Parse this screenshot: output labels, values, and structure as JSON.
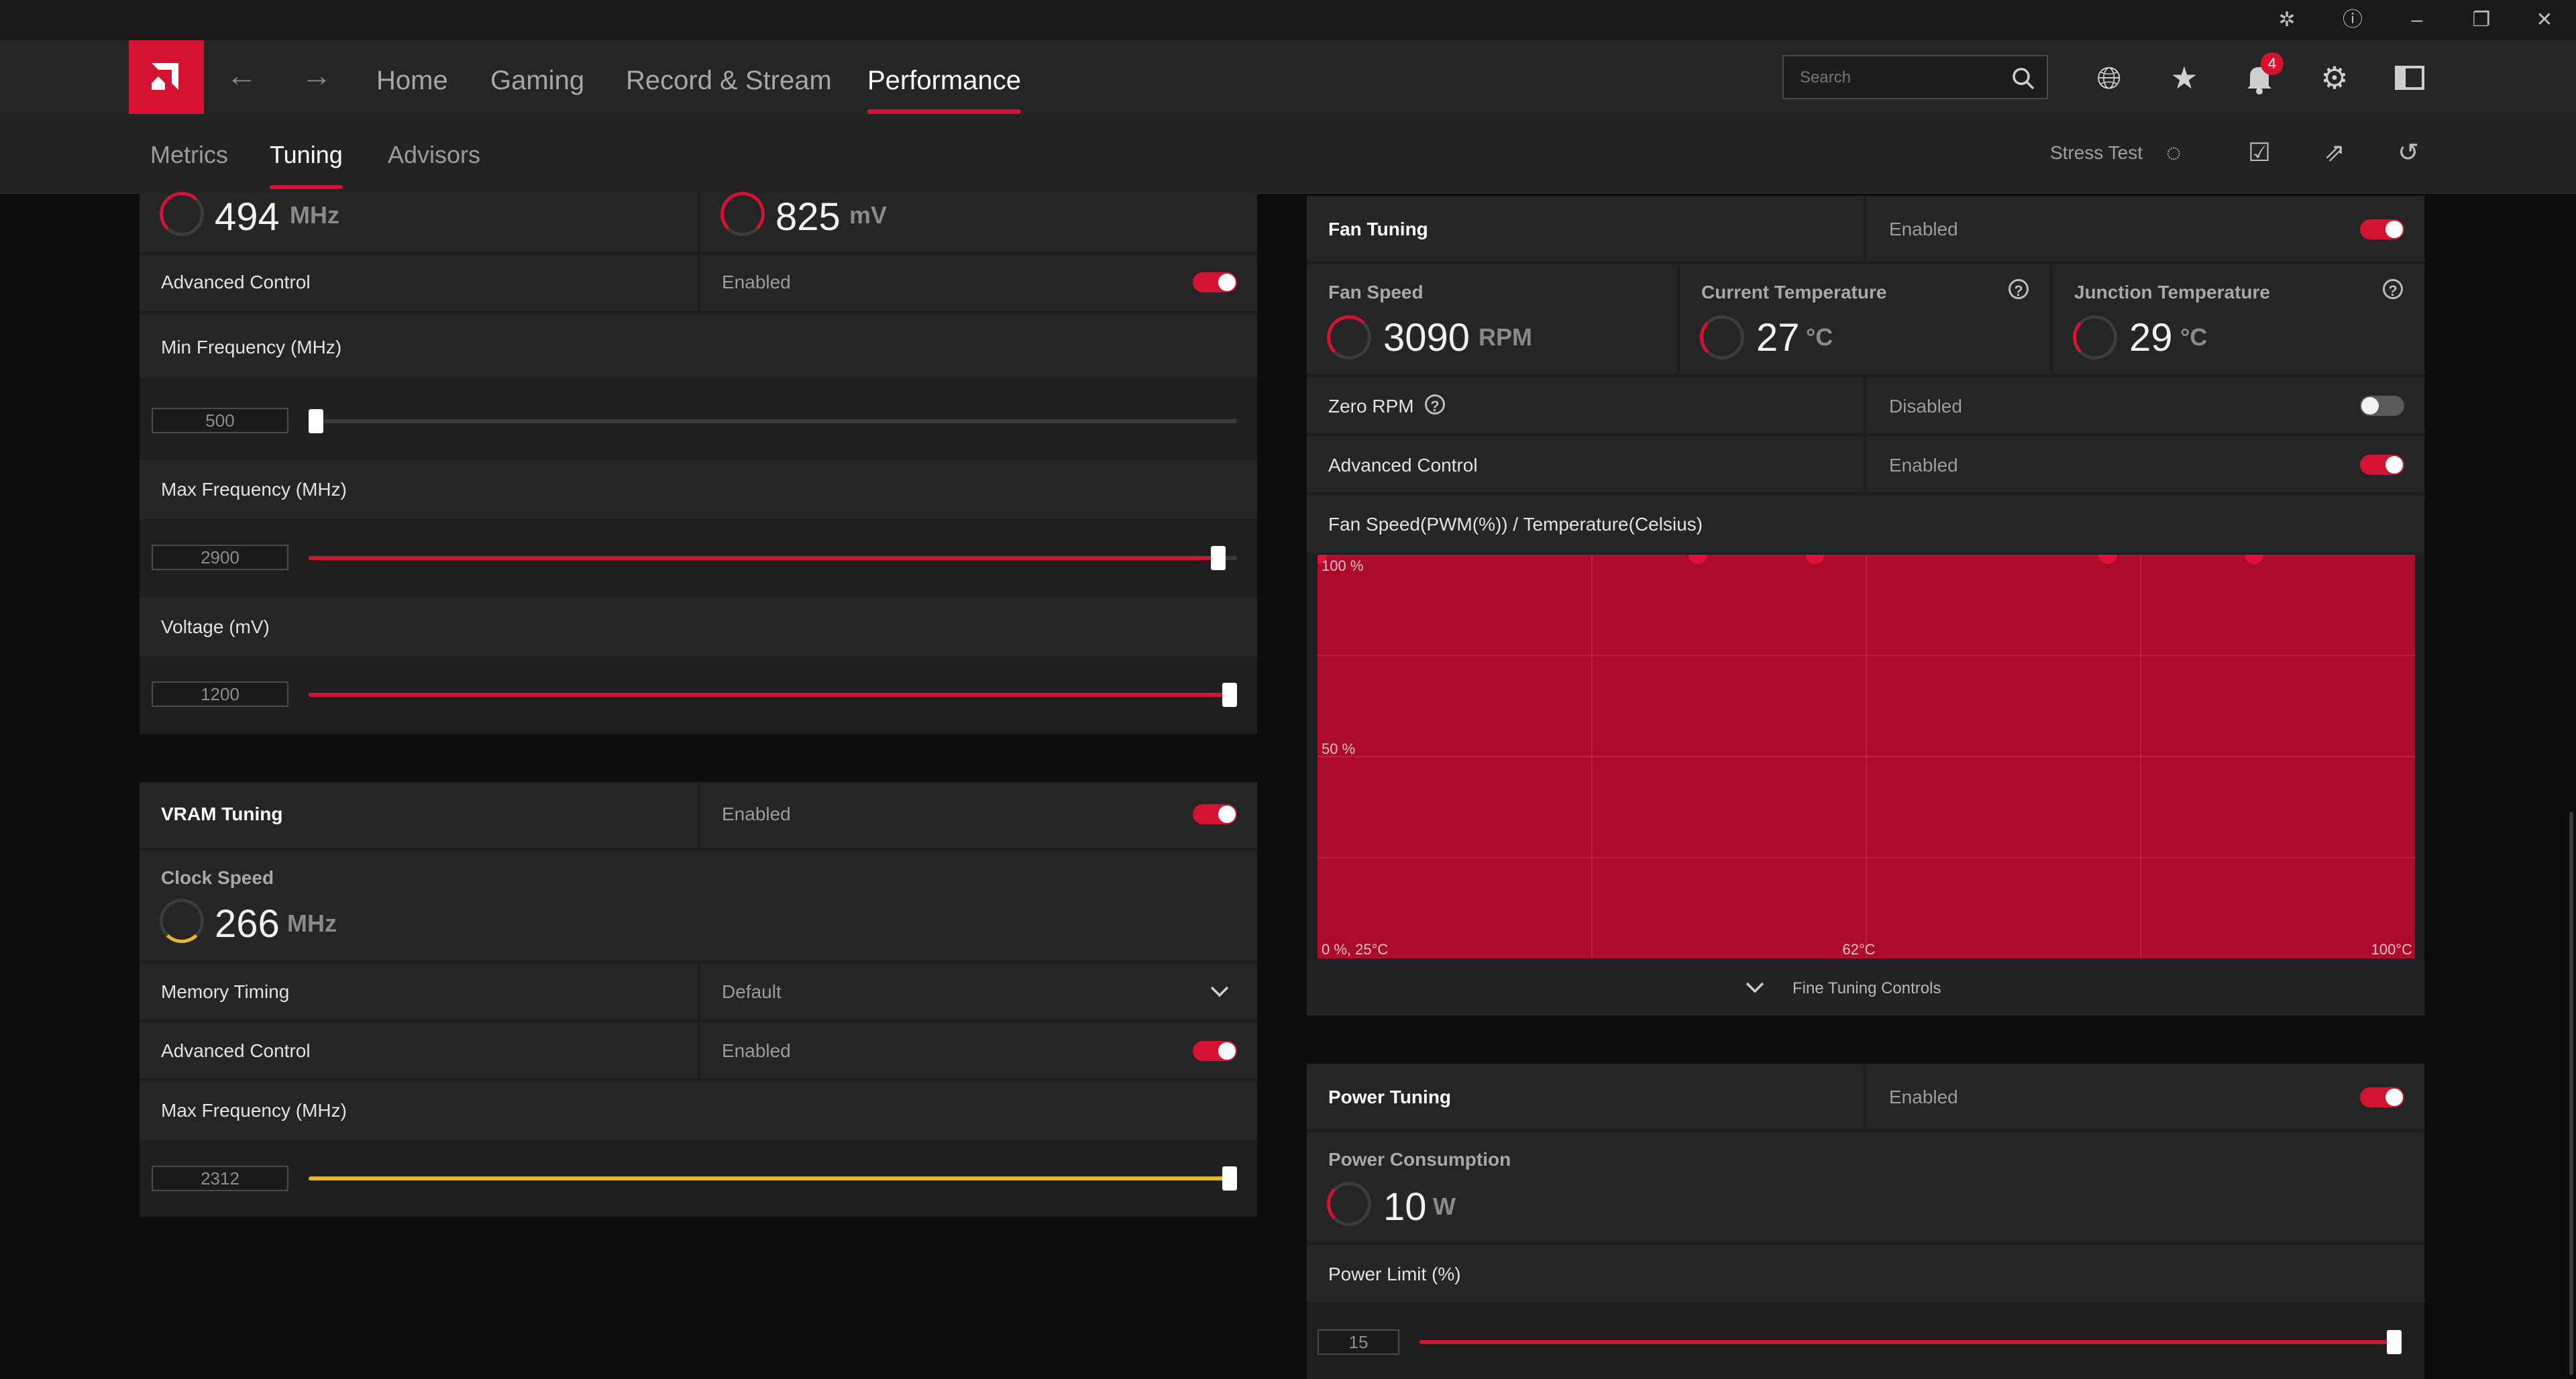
{
  "window": {
    "bug_icon": "bug-icon",
    "help_icon": "help-icon",
    "minimize_icon": "minimize-icon",
    "restore_icon": "restore-icon",
    "close_icon": "close-icon"
  },
  "nav": {
    "tabs": [
      "Home",
      "Gaming",
      "Record & Stream",
      "Performance"
    ],
    "active": "Performance",
    "search_placeholder": "Search",
    "notification_count": "4"
  },
  "subnav": {
    "tabs": [
      "Metrics",
      "Tuning",
      "Advisors"
    ],
    "active": "Tuning",
    "stress_test": "Stress Test"
  },
  "gpu": {
    "top_freq_value": "494",
    "top_freq_unit": "MHz",
    "top_voltage_value": "825",
    "top_voltage_unit": "mV",
    "advanced_control_label": "Advanced Control",
    "advanced_control_state": "Enabled",
    "min_freq_label": "Min Frequency (MHz)",
    "min_freq_value": "500",
    "min_freq_fraction": 0.0,
    "max_freq_label": "Max Frequency (MHz)",
    "max_freq_value": "2900",
    "max_freq_fraction": 0.98,
    "voltage_label": "Voltage (mV)",
    "voltage_value": "1200",
    "voltage_fraction": 1.0
  },
  "vram": {
    "title": "VRAM Tuning",
    "state": "Enabled",
    "clock_label": "Clock Speed",
    "clock_value": "266",
    "clock_unit": "MHz",
    "memory_timing_label": "Memory Timing",
    "memory_timing_value": "Default",
    "advanced_control_label": "Advanced Control",
    "advanced_control_state": "Enabled",
    "max_freq_label": "Max Frequency (MHz)",
    "max_freq_value": "2312",
    "max_freq_fraction": 1.0
  },
  "fan": {
    "title": "Fan Tuning",
    "state": "Enabled",
    "speed_label": "Fan Speed",
    "speed_value": "3090",
    "speed_unit": "RPM",
    "current_temp_label": "Current Temperature",
    "current_temp_value": "27",
    "current_temp_unit": "°C",
    "junction_temp_label": "Junction Temperature",
    "junction_temp_value": "29",
    "junction_temp_unit": "°C",
    "zero_rpm_label": "Zero RPM",
    "zero_rpm_state": "Disabled",
    "advanced_control_label": "Advanced Control",
    "advanced_control_state": "Enabled",
    "curve_title": "Fan Speed(PWM(%)) / Temperature(Celsius)",
    "fine_tuning": "Fine Tuning Controls"
  },
  "power": {
    "title": "Power Tuning",
    "state": "Enabled",
    "consumption_label": "Power Consumption",
    "consumption_value": "10",
    "consumption_unit": "W",
    "limit_label": "Power Limit (%)",
    "limit_value": "15",
    "limit_fraction": 1.0
  },
  "chart_data": {
    "type": "area",
    "x_tick_labels": [
      "0 %, 25°C",
      "62°C",
      "100°C"
    ],
    "y_tick_labels": [
      "100 %",
      "50 %"
    ],
    "xlim": [
      25,
      100
    ],
    "ylim": [
      0,
      100
    ],
    "x": [
      25,
      51,
      59,
      79,
      89
    ],
    "values": [
      100,
      100,
      100,
      100,
      100
    ],
    "fill_color": "#ad0b2b",
    "point_color": "#e0123a",
    "grid": true
  }
}
